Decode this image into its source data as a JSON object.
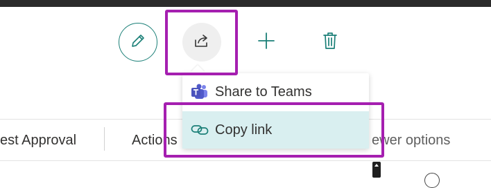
{
  "toolbar": {
    "request_approval": "est Approval",
    "actions": "Actions",
    "viewer_options": "ewer options"
  },
  "share_menu": {
    "items": [
      {
        "label": "Share to Teams",
        "icon": "teams-icon"
      },
      {
        "label": "Copy link",
        "icon": "link-icon"
      }
    ]
  },
  "icons": {
    "edit": "pencil-icon",
    "share": "share-icon",
    "add": "plus-icon",
    "delete": "trash-icon"
  },
  "colors": {
    "accent": "#1a7f77",
    "highlight": "#a51fb0",
    "selected_item": "#d9eff0",
    "teams": "#5059c9"
  }
}
